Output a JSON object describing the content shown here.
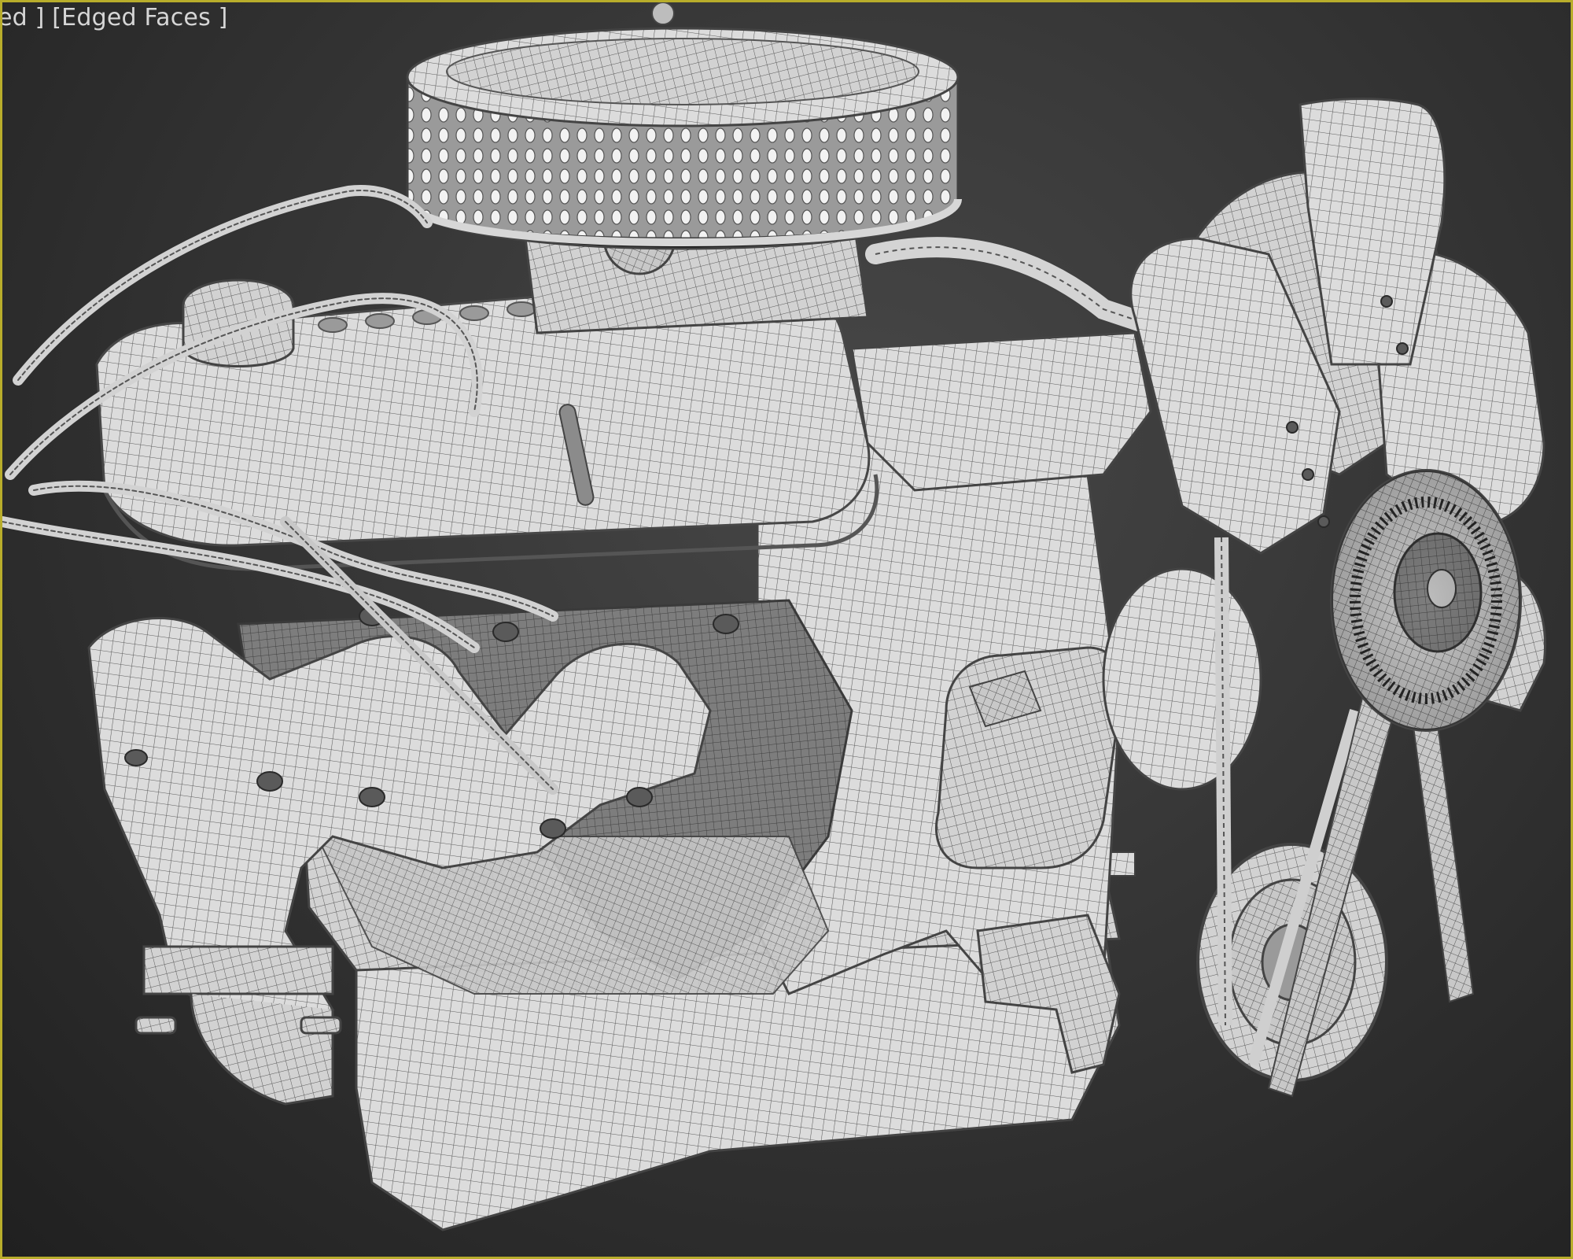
{
  "viewport": {
    "label": "ed ] [Edged Faces ]",
    "active_border_color": "#b8ad2b",
    "background_color": "#2e2e2e"
  },
  "scene": {
    "object_icon": "engine-model",
    "mesh_color": "#d9d9d9",
    "wire_color": "#6a6a6a"
  }
}
